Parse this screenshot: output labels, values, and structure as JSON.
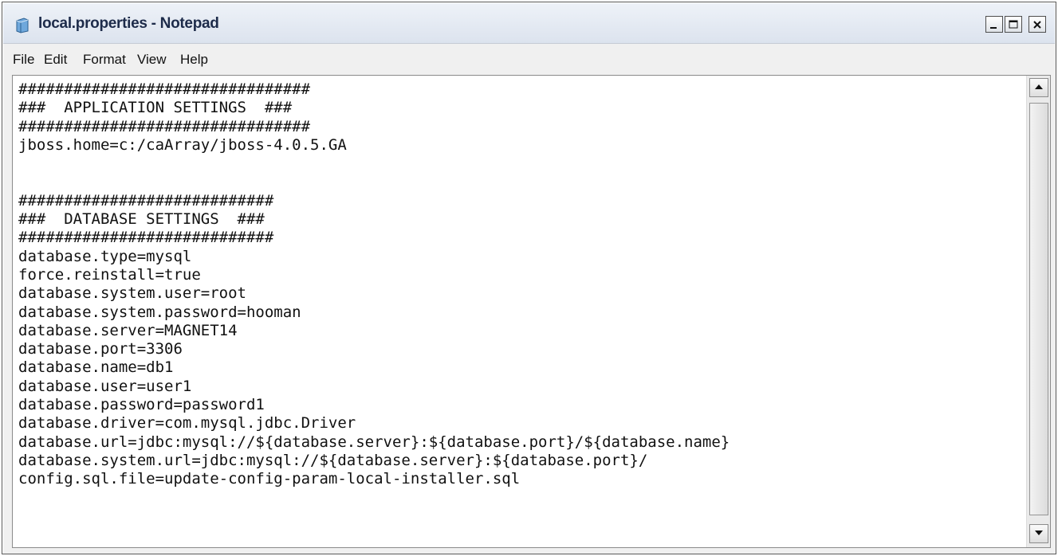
{
  "window": {
    "title": "local.properties - Notepad",
    "icon": "notepad-icon",
    "controls": [
      "minimize-icon",
      "maximize-icon",
      "close-icon"
    ]
  },
  "menu": {
    "file": "File",
    "edit": "Edit",
    "format": "Format",
    "view": "View",
    "help": "Help"
  },
  "editor": {
    "lines": [
      "################################",
      "###  APPLICATION SETTINGS  ###",
      "################################",
      "jboss.home=c:/caArray/jboss-4.0.5.GA",
      "",
      "",
      "############################",
      "###  DATABASE SETTINGS  ###",
      "############################",
      "database.type=mysql",
      "force.reinstall=true",
      "database.system.user=root",
      "database.system.password=hooman",
      "database.server=MAGNET14",
      "database.port=3306",
      "database.name=db1",
      "database.user=user1",
      "database.password=password1",
      "database.driver=com.mysql.jdbc.Driver",
      "database.url=jdbc:mysql://${database.server}:${database.port}/${database.name}",
      "database.system.url=jdbc:mysql://${database.server}:${database.port}/",
      "config.sql.file=update-config-param-local-installer.sql"
    ]
  },
  "colors": {
    "titlebar": "#dce3ee",
    "title_text": "#1d2b4a",
    "editor_bg": "#ffffff"
  }
}
